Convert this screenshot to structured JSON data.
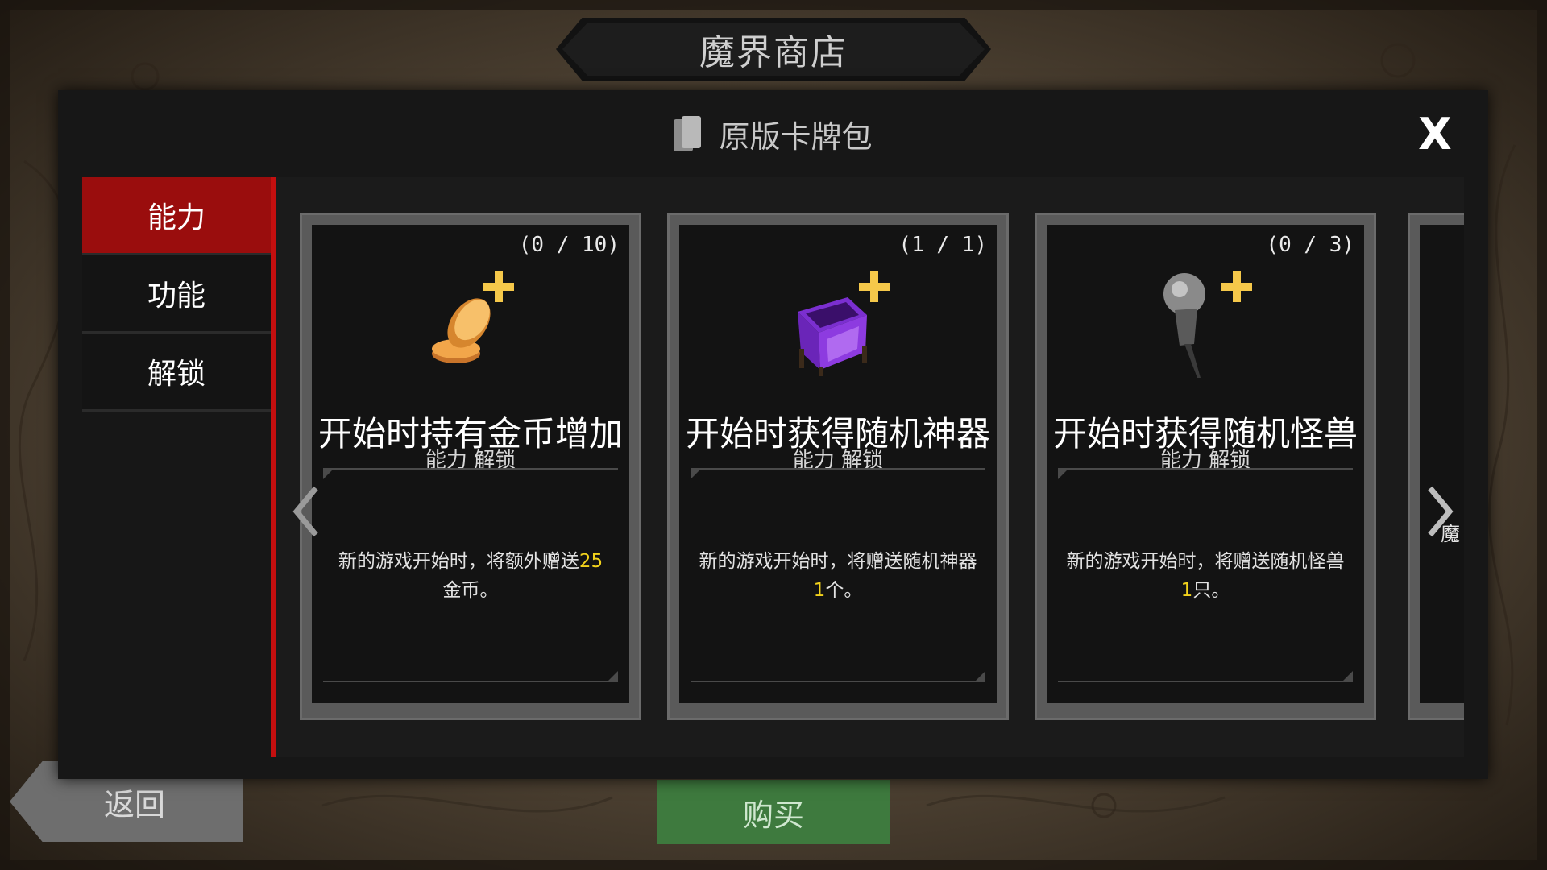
{
  "shop": {
    "title": "魔界商店"
  },
  "panel": {
    "title": "原版卡牌包",
    "close_label": "X"
  },
  "tabs": [
    {
      "label": "能力",
      "active": true
    },
    {
      "label": "功能",
      "active": false
    },
    {
      "label": "解锁",
      "active": false
    }
  ],
  "cards": [
    {
      "count": "(0 / 10)",
      "name": "开始时持有金币增加",
      "type": "能力 解锁",
      "desc_pre": "新的游戏开始时，将额外赠送",
      "desc_hl": "25",
      "desc_post": "金币。",
      "icon": "gold-coin-plus-icon"
    },
    {
      "count": "(1 / 1)",
      "name": "开始时获得随机神器",
      "type": "能力 解锁",
      "desc_pre": "新的游戏开始时，将赠送随机神器",
      "desc_hl": "1",
      "desc_post": "个。",
      "icon": "purple-chest-plus-icon"
    },
    {
      "count": "(0 / 3)",
      "name": "开始时获得随机怪兽",
      "type": "能力 解锁",
      "desc_pre": "新的游戏开始时，将赠送随机怪兽",
      "desc_hl": "1",
      "desc_post": "只。",
      "icon": "pin-plus-icon"
    }
  ],
  "partial_card": {
    "desc_first_char": "魔"
  },
  "buttons": {
    "back": "返回",
    "buy": "购买"
  },
  "colors": {
    "active_tab": "#9a0d0d",
    "highlight": "#f2d21c",
    "buy": "#3e7a3e"
  }
}
